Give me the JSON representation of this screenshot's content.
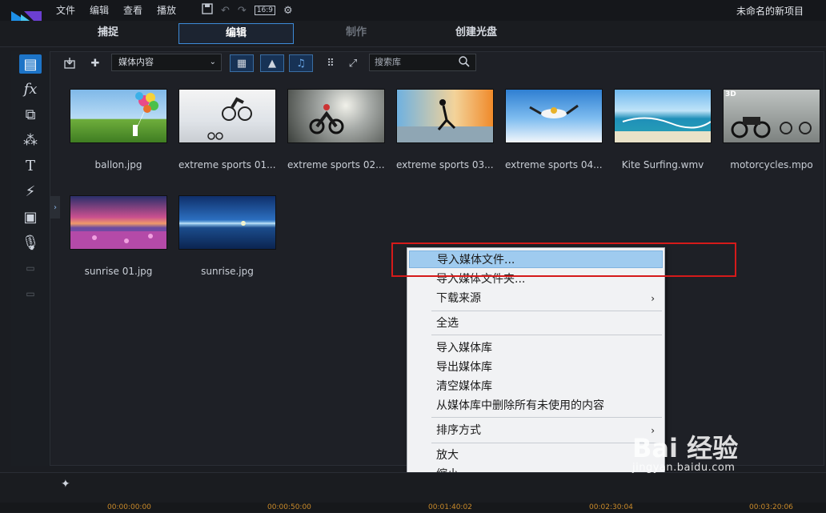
{
  "menu": {
    "file": "文件",
    "edit": "编辑",
    "view": "查看",
    "play": "播放"
  },
  "toolbar_icons": {
    "aspect": "16:9",
    "aspect_icon": "aspect-ratio-icon"
  },
  "project_title": "未命名的新项目",
  "modes": {
    "capture": "捕捉",
    "edit": "编辑",
    "produce": "制作",
    "disc": "创建光盘"
  },
  "library": {
    "dropdown": "媒体内容",
    "search_placeholder": "搜索库",
    "items": [
      {
        "name": "ballon.jpg",
        "badge": ""
      },
      {
        "name": "extreme sports 01....",
        "badge": ""
      },
      {
        "name": "extreme sports 02....",
        "badge": ""
      },
      {
        "name": "extreme sports 03....",
        "badge": ""
      },
      {
        "name": "extreme sports 04....",
        "badge": ""
      },
      {
        "name": "Kite Surfing.wmv",
        "badge": ""
      },
      {
        "name": "motorcycles.mpo",
        "badge": "3D"
      },
      {
        "name": "sunrise 01.jpg",
        "badge": ""
      },
      {
        "name": "sunrise.jpg",
        "badge": ""
      }
    ]
  },
  "context_menu": {
    "import_files": "导入媒体文件...",
    "import_folder": "导入媒体文件夹...",
    "download": "下载来源",
    "select_all": "全选",
    "import_library": "导入媒体库",
    "export_library": "导出媒体库",
    "clear_library": "清空媒体库",
    "remove_unused": "从媒体库中删除所有未使用的内容",
    "sort_by": "排序方式",
    "zoom_in": "放大",
    "zoom_out": "缩小",
    "submenu_arrow": "›"
  },
  "timecodes": [
    "00:00:00:00",
    "00:00:50:00",
    "00:01:40:02",
    "00:02:30:04",
    "00:03:20:06"
  ],
  "watermark": {
    "line1": "Bai 经验",
    "line2": "jingyan.baidu.com"
  },
  "colors": {
    "accent": "#1d74c7",
    "highlight": "#9fcbef",
    "annotation": "#d51a1a"
  }
}
